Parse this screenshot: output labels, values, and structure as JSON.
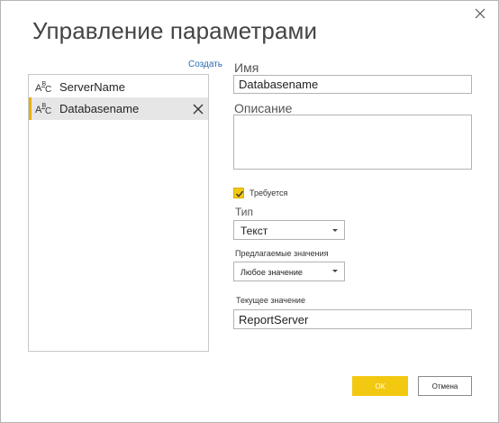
{
  "dialog": {
    "title": "Управление параметрами",
    "close_icon": "close-icon"
  },
  "sidebar": {
    "create_label": "Создать",
    "items": [
      {
        "label": "ServerName",
        "icon": "text-type-icon",
        "selected": false
      },
      {
        "label": "Databasename",
        "icon": "text-type-icon",
        "selected": true
      }
    ],
    "selection_color": "#e8b00f"
  },
  "form": {
    "name_label": "Имя",
    "name_value": "Databasename",
    "description_label": "Описание",
    "description_value": "",
    "required_label": "Требуется",
    "required_checked": true,
    "type_label": "Тип",
    "type_value": "Текст",
    "suggested_label": "Предлагаемые значения",
    "suggested_value": "Любое значение",
    "current_label": "Текущее значение",
    "current_value": "ReportServer"
  },
  "footer": {
    "ok_label": "ОК",
    "cancel_label": "Отмена",
    "accent_color": "#f2c811"
  }
}
